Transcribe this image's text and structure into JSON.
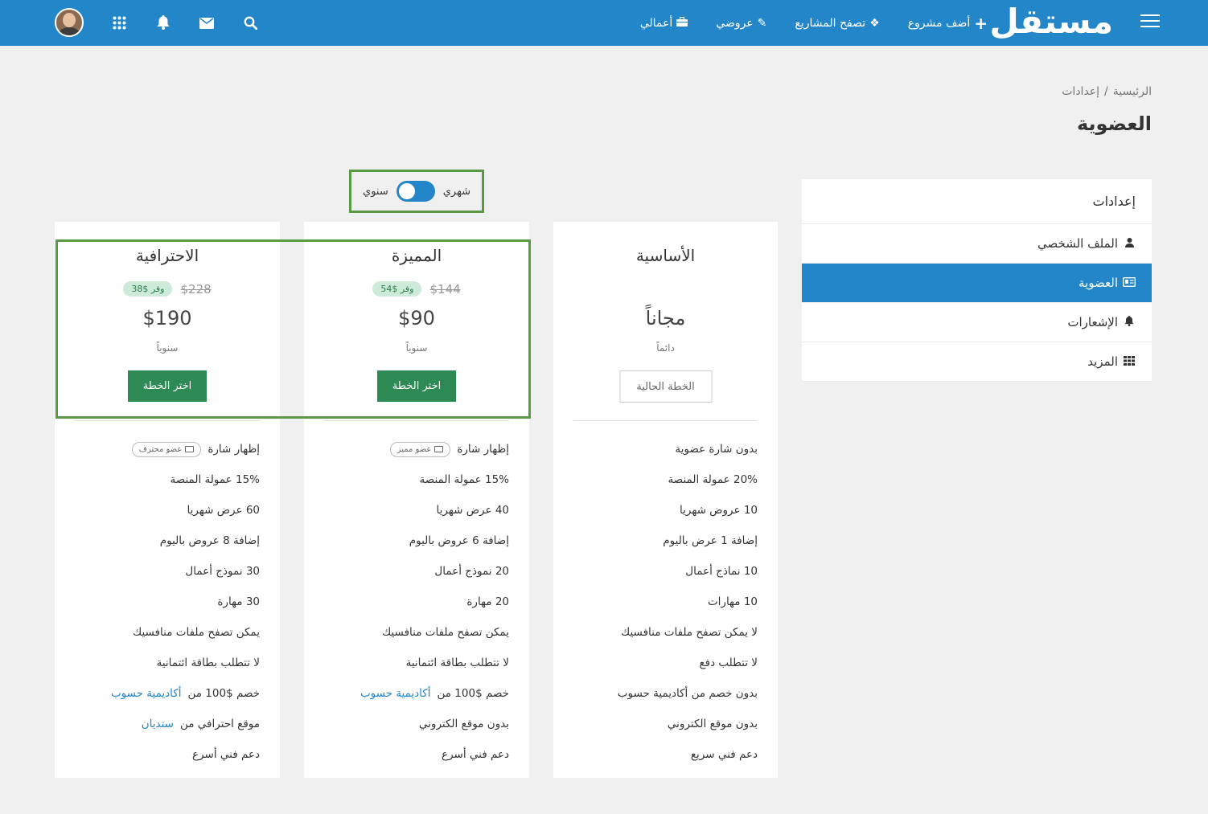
{
  "header": {
    "logo": "مستقل",
    "nav": [
      {
        "label": "أضف مشروع",
        "icon": "plus-icon"
      },
      {
        "label": "تصفح المشاريع",
        "icon": "cubes-icon"
      },
      {
        "label": "عروضي",
        "icon": "edit-icon"
      },
      {
        "label": "أعمالي",
        "icon": "briefcase-icon"
      }
    ]
  },
  "breadcrumb": {
    "home": "الرئيسية",
    "separator": "/",
    "current": "إعدادات"
  },
  "page_title": "العضوية",
  "sidebar": {
    "heading": "إعدادات",
    "items": [
      {
        "label": "الملف الشخصي",
        "icon": "user-icon",
        "active": false
      },
      {
        "label": "العضوية",
        "icon": "id-card-icon",
        "active": true
      },
      {
        "label": "الإشعارات",
        "icon": "bell-icon",
        "active": false
      },
      {
        "label": "المزيد",
        "icon": "grid-icon",
        "active": false
      }
    ]
  },
  "billing_toggle": {
    "monthly_label": "شهري",
    "yearly_label": "سنوي",
    "selected": "monthly"
  },
  "plans": [
    {
      "name": "الأساسية",
      "price": "مجاناً",
      "period": "دائماً",
      "button": "الخطة الحالية",
      "features": [
        "بدون شارة عضوية",
        "20% عمولة المنصة",
        "10 عروض شهريا",
        "إضافة 1 عرض باليوم",
        "10 نماذج أعمال",
        "10 مهارات",
        "لا يمكن تصفح ملفات منافسيك",
        "لا تتطلب دفع",
        "بدون خصم من أكاديمية حسوب",
        "بدون موقع الكتروني",
        "دعم فني سريع"
      ]
    },
    {
      "name": "المميزة",
      "old_price": "$144",
      "save": "وفر $54",
      "price": "$90",
      "period": "سنوياً",
      "button": "اختر الخطة",
      "badge_text": "إظهار شارة",
      "badge_label": "عضو مميز",
      "features": [
        "15% عمولة المنصة",
        "40 عرض شهريا",
        "إضافة 6 عروض باليوم",
        "20 نموذج أعمال",
        "20 مهارة",
        "يمكن تصفح ملفات منافسيك",
        "لا تتطلب بطاقة ائتمانية"
      ],
      "discount_prefix": "خصم $100 من",
      "discount_link": "أكاديمية حسوب",
      "website": "بدون موقع الكتروني",
      "support": "دعم فني أسرع"
    },
    {
      "name": "الاحترافية",
      "old_price": "$228",
      "save": "وفر $38",
      "price": "$190",
      "period": "سنوياً",
      "button": "اختر الخطة",
      "badge_text": "إظهار شارة",
      "badge_label": "عضو محترف",
      "features": [
        "15% عمولة المنصة",
        "60 عرض شهريا",
        "إضافة 8 عروض باليوم",
        "30 نموذج أعمال",
        "30 مهارة",
        "يمكن تصفح ملفات منافسيك",
        "لا تتطلب بطاقة ائتمانية"
      ],
      "discount_prefix": "خصم $100 من",
      "discount_link": "أكاديمية حسوب",
      "website_prefix": "موقع احترافي من",
      "website_link": "ستديان",
      "support": "دعم فني أسرع"
    }
  ]
}
